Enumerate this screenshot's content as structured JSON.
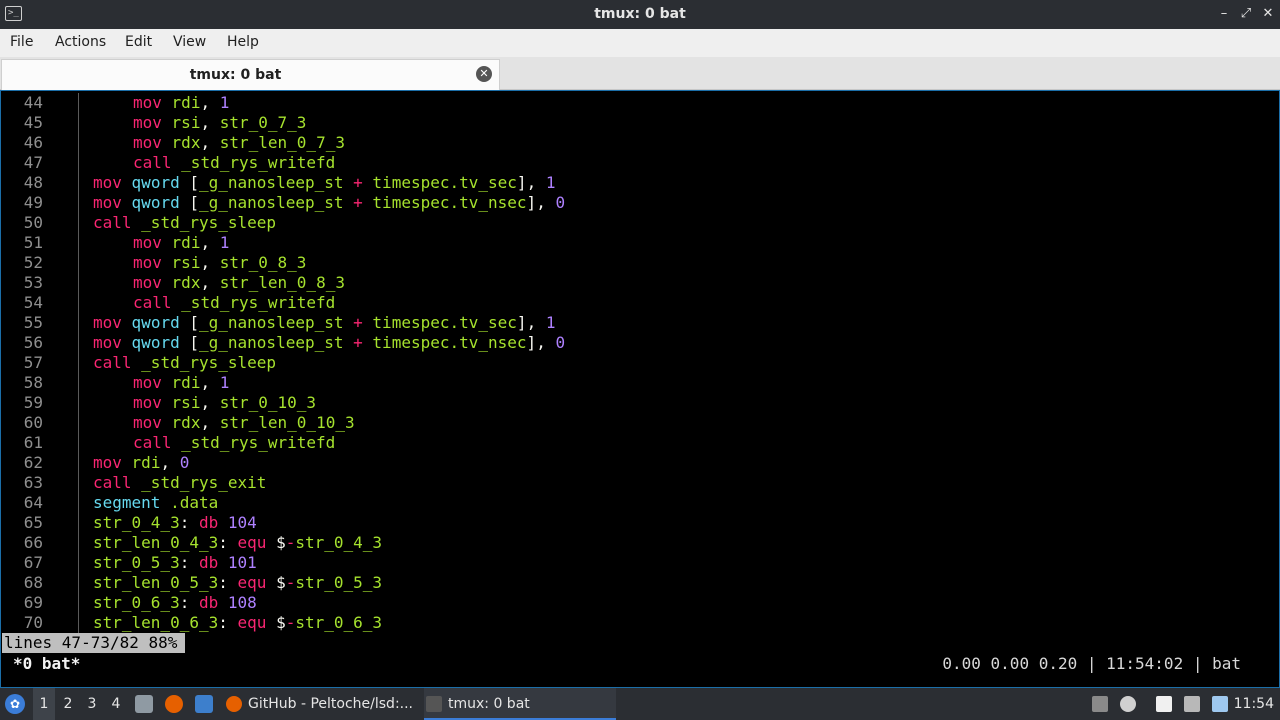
{
  "window": {
    "title": "tmux: 0 bat",
    "app_icon_glyph": ">_",
    "controls": {
      "minimize": "–",
      "maximize": "⤢",
      "close": "✕"
    }
  },
  "menu": [
    "File",
    "Actions",
    "Edit",
    "View",
    "Help"
  ],
  "tab": {
    "label": "tmux: 0 bat",
    "close_glyph": "✕"
  },
  "terminal": {
    "lines": [
      {
        "n": "44",
        "indent": true,
        "text": "mov rdi, 1"
      },
      {
        "n": "45",
        "indent": true,
        "text": "mov rsi, str_0_7_3"
      },
      {
        "n": "46",
        "indent": true,
        "text": "mov rdx, str_len_0_7_3"
      },
      {
        "n": "47",
        "indent": true,
        "text": "call _std_rys_writefd"
      },
      {
        "n": "48",
        "indent": false,
        "text": "mov qword [_g_nanosleep_st + timespec.tv_sec], 1"
      },
      {
        "n": "49",
        "indent": false,
        "text": "mov qword [_g_nanosleep_st + timespec.tv_nsec], 0"
      },
      {
        "n": "50",
        "indent": false,
        "text": "call _std_rys_sleep"
      },
      {
        "n": "51",
        "indent": true,
        "text": "mov rdi, 1"
      },
      {
        "n": "52",
        "indent": true,
        "text": "mov rsi, str_0_8_3"
      },
      {
        "n": "53",
        "indent": true,
        "text": "mov rdx, str_len_0_8_3"
      },
      {
        "n": "54",
        "indent": true,
        "text": "call _std_rys_writefd"
      },
      {
        "n": "55",
        "indent": false,
        "text": "mov qword [_g_nanosleep_st + timespec.tv_sec], 1"
      },
      {
        "n": "56",
        "indent": false,
        "text": "mov qword [_g_nanosleep_st + timespec.tv_nsec], 0"
      },
      {
        "n": "57",
        "indent": false,
        "text": "call _std_rys_sleep"
      },
      {
        "n": "58",
        "indent": true,
        "text": "mov rdi, 1"
      },
      {
        "n": "59",
        "indent": true,
        "text": "mov rsi, str_0_10_3"
      },
      {
        "n": "60",
        "indent": true,
        "text": "mov rdx, str_len_0_10_3"
      },
      {
        "n": "61",
        "indent": true,
        "text": "call _std_rys_writefd"
      },
      {
        "n": "62",
        "indent": false,
        "text": "mov rdi, 0"
      },
      {
        "n": "63",
        "indent": false,
        "text": "call _std_rys_exit"
      },
      {
        "n": "64",
        "indent": false,
        "text": "segment .data"
      },
      {
        "n": "65",
        "indent": false,
        "text": "str_0_4_3: db 104"
      },
      {
        "n": "66",
        "indent": false,
        "text": "str_len_0_4_3: equ $-str_0_4_3"
      },
      {
        "n": "67",
        "indent": false,
        "text": "str_0_5_3: db 101"
      },
      {
        "n": "68",
        "indent": false,
        "text": "str_len_0_5_3: equ $-str_0_5_3"
      },
      {
        "n": "69",
        "indent": false,
        "text": "str_0_6_3: db 108"
      },
      {
        "n": "70",
        "indent": false,
        "text": "str_len_0_6_3: equ $-str_0_6_3"
      }
    ],
    "pager_status": "lines 47-73/82 88%",
    "tmux_window": "*0 bat*",
    "tmux_right": "0.00 0.00 0.20 | 11:54:02 | bat"
  },
  "taskbar": {
    "desktops": [
      "1",
      "2",
      "3",
      "4"
    ],
    "active_desktop": "1",
    "tasks": [
      {
        "label": "GitHub - Peltoche/lsd:...",
        "icon": "firefox-icon",
        "active": false
      },
      {
        "label": "tmux: 0 bat",
        "icon": "terminal-icon",
        "active": true
      }
    ],
    "clock": "11:54"
  },
  "colors": {
    "keyword": "#f92672",
    "register": "#a6e22e",
    "number": "#ae81ff",
    "directive": "#66d9ef",
    "line_number": "#8f8f8f",
    "titlebar": "#2b2e33",
    "accent": "#3b7dd8"
  }
}
